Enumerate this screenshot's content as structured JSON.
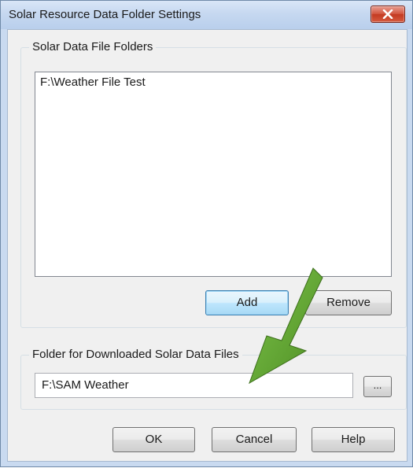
{
  "window": {
    "title": "Solar Resource Data Folder Settings"
  },
  "folders_group": {
    "label": "Solar Data File Folders",
    "items": [
      "F:\\Weather File Test"
    ],
    "add_label": "Add",
    "remove_label": "Remove"
  },
  "download_group": {
    "label": "Folder for Downloaded Solar Data Files",
    "folder_value": "F:\\SAM Weather",
    "browse_label": "..."
  },
  "buttons": {
    "ok_label": "OK",
    "cancel_label": "Cancel",
    "help_label": "Help"
  },
  "colors": {
    "annotation_arrow": "#5a9a2a",
    "close_button": "#c33a22"
  },
  "icons": {
    "close": "close-x-icon",
    "annotation": "green-arrow-annotation"
  }
}
